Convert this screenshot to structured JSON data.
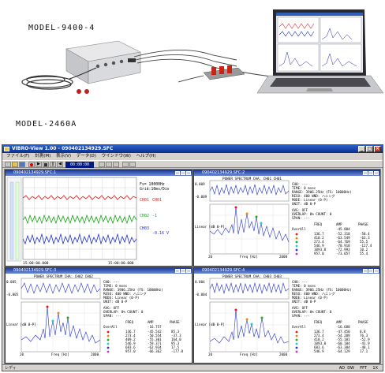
{
  "photo": {
    "model_top": "MODEL-9400-4",
    "model_bottom": "MODEL-2460A"
  },
  "app": {
    "title": "VIBRO-View 1.00 - 090402134929.SFC",
    "menu": [
      "ファイル(F)",
      "計測(M)",
      "表示(V)",
      "データ(D)",
      "ウインドウ(W)",
      "ヘルプ(H)"
    ],
    "toolbar_time": "00:00:00",
    "status_left": "レディ",
    "status_right": [
      "AD",
      "DW",
      "FFT",
      "1X"
    ]
  },
  "windows": {
    "w1": {
      "title": "090402134929.SFC:1",
      "info": [
        "Fs= 10000Hz",
        "Grid:10ms/Div"
      ],
      "channels": [
        {
          "name": "CH01",
          "value": "CH01",
          "color": "#dd2020"
        },
        {
          "name": "CH02",
          "value": "-1",
          "color": "#19a519"
        },
        {
          "name": "CH03",
          "value": "-0.16 V",
          "color": "#2233cc"
        }
      ],
      "x_start": "15:00:00.000",
      "x_end": "15:00:00.000"
    },
    "w2": {
      "title": "090402134929.SFC:2",
      "header": "POWER SPECTRUM  CHA: CH01 CH01",
      "wave_ylim": [
        "0.009",
        "-0.009"
      ],
      "params": [
        "CH0: ---",
        "TIME: 0 msec",
        "RANGE: 3906.25Hz (FS: 10000Hz)",
        "RESO: 400  WND: ハニング",
        "MODE: Linear (0-P)",
        "UNIT: dB 0-P"
      ],
      "avg": [
        "AVG: OFF",
        "OVERLAP: 0%  COUNT: 0",
        "SPAN: ---"
      ],
      "ylabel": "Linear\n[dB 0-P]",
      "xlabel": "Freq [Hz]",
      "x_ticks": [
        "20",
        "100",
        "2000"
      ],
      "table_header": [
        "FREQ",
        "AMP",
        "PHASE"
      ],
      "overall": "-45.804",
      "rows": [
        [
          "136.7",
          "-52.318",
          "-58.4"
        ],
        [
          "410.2",
          "-63.549",
          "-63.3"
        ],
        [
          "273.4",
          "-64.769",
          "55.5"
        ],
        [
          "546.9",
          "-70.918",
          "-127.4"
        ],
        [
          "1093.8",
          "-72.993",
          "10.2"
        ],
        [
          "957.0",
          "-73.057",
          "55.4"
        ]
      ]
    },
    "w3": {
      "title": "090402134929.SFC:3",
      "header": "POWER SPECTRUM  CHA: CH02 CH02",
      "wave_ylim": [
        "0.005",
        "-0.005"
      ],
      "params": [
        "CH0: ---",
        "TIME: 0 msec",
        "RANGE: 3906.25Hz (FS: 10000Hz)",
        "RESO: 400  WND: ハニング",
        "MODE: Linear (0-P)",
        "UNIT: dB 0-P"
      ],
      "avg": [
        "AVG: OFF",
        "OVERLAP: 0%  COUNT: 0",
        "SPAN: ---"
      ],
      "ylabel": "Linear\n[dB 0-P]",
      "xlabel": "Freq [Hz]",
      "x_ticks": [
        "20",
        "100",
        "2000"
      ],
      "table_header": [
        "FREQ",
        "AMP",
        "PHASE"
      ],
      "overall": "-16.757",
      "rows": [
        [
          "136.7",
          "-45.542",
          "85.3"
        ],
        [
          "273.4",
          "-50.554",
          "-37.3"
        ],
        [
          "409.2",
          "-55.301",
          "164.0"
        ],
        [
          "546.9",
          "-59.371",
          "95.3"
        ],
        [
          "683.6",
          "-62.934",
          "17.5"
        ],
        [
          "957.0",
          "-66.362",
          "-177.0"
        ]
      ]
    },
    "w4": {
      "title": "090402134929.SFC:4",
      "header": "POWER SPECTRUM  CHA: CH03 CH03",
      "wave_ylim": [
        "0.004",
        "-0.004"
      ],
      "params": [
        "CH0: ---",
        "TIME: 0 msec",
        "RANGE: 3906.25Hz (FS: 10000Hz)",
        "RESO: 400  WND: ハニング",
        "MODE: Linear (0-P)",
        "UNIT: dB 0-P"
      ],
      "avg": [
        "AVG: OFF",
        "OVERLAP: 0%  COUNT: 0",
        "SPAN: ---"
      ],
      "ylabel": "Linear\n[dB 0-P]",
      "xlabel": "Freq [Hz]",
      "x_ticks": [
        "20",
        "100",
        "2000"
      ],
      "table_header": [
        "FREQ",
        "AMP",
        "PHASE"
      ],
      "overall": "-16.688",
      "rows": [
        [
          "136.7",
          "-47.450",
          "0.8"
        ],
        [
          "273.4",
          "-54.209",
          "76.3"
        ],
        [
          "410.2",
          "-55.181",
          "-52.9"
        ],
        [
          "1093.8",
          "-60.104",
          "-41.9"
        ],
        [
          "683.6",
          "-63.384",
          "-48.1"
        ],
        [
          "546.9",
          "-64.129",
          "17.1"
        ]
      ]
    }
  }
}
